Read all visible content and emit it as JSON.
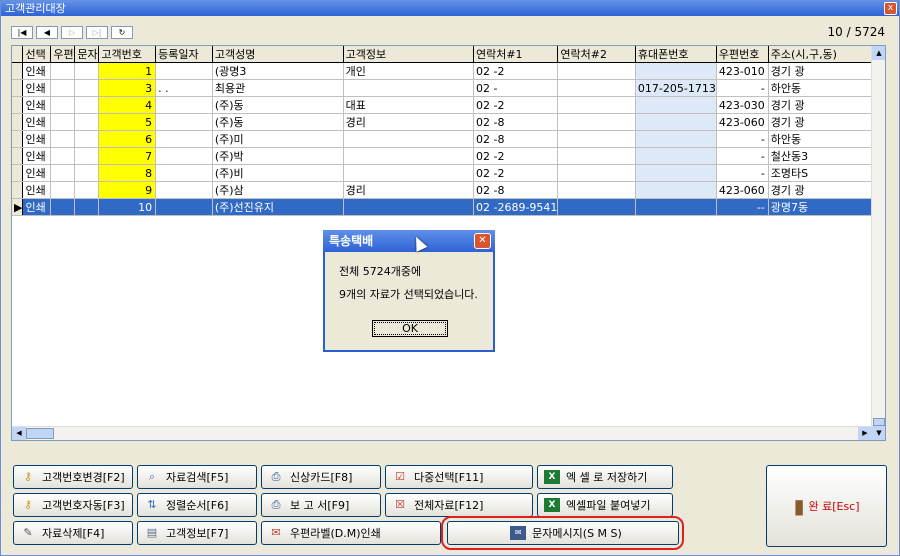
{
  "window": {
    "title": "고객관리대장",
    "close_label": "x"
  },
  "nav": {
    "buttons": [
      "|◀",
      "◀",
      "▷",
      "▷|",
      "↻"
    ],
    "counter": "10 / 5724"
  },
  "table": {
    "columns": [
      "선택",
      "우편",
      "문자",
      "고객번호",
      "등록일자",
      "고객성명",
      "고객정보",
      "연락처#1",
      "연락처#2",
      "휴대폰번호",
      "우편번호",
      "주소(시,구,동)"
    ],
    "rows": [
      [
        "인쇄",
        "",
        "",
        "1",
        "",
        "(광명3",
        "개인",
        "02  -2",
        "",
        "",
        "423-010",
        "경기 광"
      ],
      [
        "인쇄",
        "",
        "",
        "3",
        ".  .",
        "최용관",
        "",
        "02  -",
        "",
        "017-205-1713",
        "-",
        "하안동"
      ],
      [
        "인쇄",
        "",
        "",
        "4",
        "",
        "(주)동",
        "대표",
        "02  -2",
        "",
        "",
        "423-030",
        "경기 광"
      ],
      [
        "인쇄",
        "",
        "",
        "5",
        "",
        "(주)동",
        "경리",
        "02  -8",
        "",
        "",
        "423-060",
        "경기 광"
      ],
      [
        "인쇄",
        "",
        "",
        "6",
        "",
        "(주)미",
        "",
        "02  -8",
        "",
        "",
        "-",
        "하안동"
      ],
      [
        "인쇄",
        "",
        "",
        "7",
        "",
        "(주)박",
        "",
        "02  -2",
        "",
        "",
        "-",
        "철산동3"
      ],
      [
        "인쇄",
        "",
        "",
        "8",
        "",
        "(주)비",
        "",
        "02  -2",
        "",
        "",
        "-",
        "조명타S"
      ],
      [
        "인쇄",
        "",
        "",
        "9",
        "",
        "(주)삼",
        "경리",
        "02  -8",
        "",
        "",
        "423-060",
        "경기 광"
      ],
      [
        "인쇄",
        "",
        "",
        "10",
        "",
        "(주)선진유지",
        "",
        "02  -2689-9541",
        "",
        "",
        "--",
        "광명7동"
      ]
    ]
  },
  "dialog": {
    "title": "특송택배",
    "line1": "전체 5724개중에",
    "line2": "9개의 자료가 선택되었습니다.",
    "ok": "OK"
  },
  "buttons": {
    "b1": "고객번호변경[F2]",
    "b2": "자료검색[F5]",
    "b3": "신상카드[F8]",
    "b4": "다중선택[F11]",
    "b5": "엑 셀 로 저장하기",
    "b6": "고객번호자동[F3]",
    "b7": "정렬순서[F6]",
    "b8": "보 고 서[F9]",
    "b9": "전체자료[F12]",
    "b10": "엑셀파일 붙여넣기",
    "b11": "자료삭제[F4]",
    "b12": "고객정보[F7]",
    "b13": "우편라벨(D.M)인쇄",
    "b14": "문자메시지(S M S)",
    "exit": "완 료[Esc]"
  },
  "icons": {
    "key": "key-icon",
    "excel": "excel-icon",
    "printer": "printer-icon",
    "search": "search-icon",
    "door": "door-icon"
  }
}
